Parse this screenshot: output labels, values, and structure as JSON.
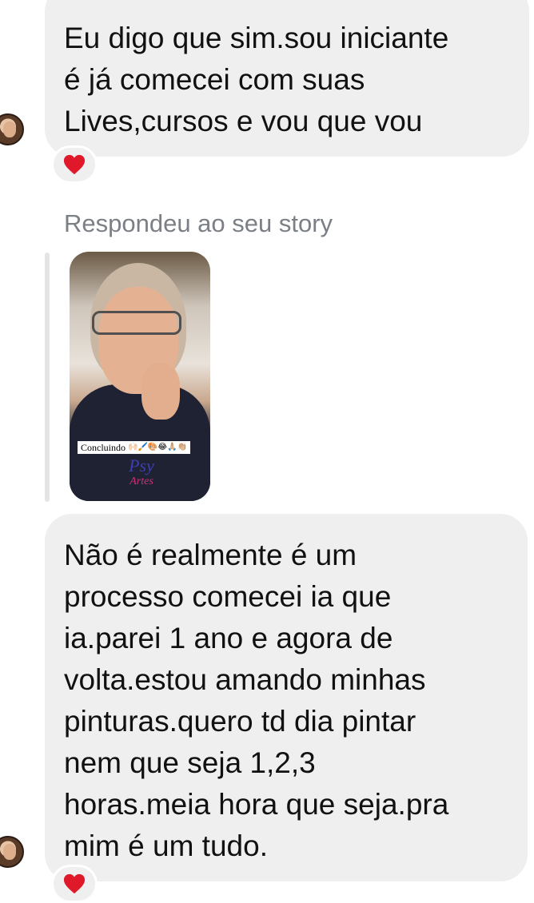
{
  "messages": [
    {
      "text": "Eu digo que sim.sou iniciante\né já comecei com suas\nLives,cursos e vou que vou",
      "reaction": "heart"
    },
    {
      "text": "Não é realmente é um\nprocesso comecei ia que\nia.parei 1 ano e agora de\nvolta.estou amando minhas\npinturas.quero td dia pintar\nnem que seja 1,2,3\nhoras.meia hora que seja.pra\nmim é um tudo.",
      "reaction": "heart"
    }
  ],
  "story_reply": {
    "caption": "Respondeu ao seu story",
    "sticker_text": "Concluindo",
    "sticker_emojis": "🙌🏻🖌️🎨😂🙏🏼👏🏼",
    "logo_text": "Psy",
    "logo_sub": "Artes"
  },
  "colors": {
    "bubble": "#efefef",
    "caption": "#7b7f86",
    "heart": "#e0192a"
  }
}
